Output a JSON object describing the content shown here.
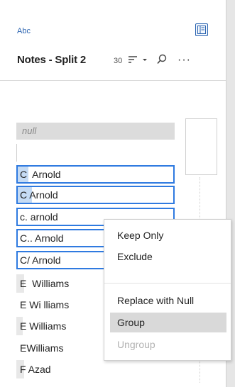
{
  "field": {
    "type_label": "Abc",
    "name": "Notes - Split 2",
    "count": "30"
  },
  "null_value": "null",
  "values": [
    {
      "label": "C  Arnold",
      "selected": true,
      "fill": 0.07
    },
    {
      "label": "C Arnold",
      "selected": true,
      "fill": 0.09
    },
    {
      "label": "c. arnold",
      "selected": true,
      "fill": 0.0
    },
    {
      "label": "C.. Arnold",
      "selected": true,
      "fill": 0.0
    },
    {
      "label": "C/ Arnold",
      "selected": true,
      "fill": 0.0
    },
    {
      "label": "E  Williams",
      "selected": false,
      "fill": 0.05
    },
    {
      "label": "E Wi lliams",
      "selected": false,
      "fill": 0.0
    },
    {
      "label": "E Williams",
      "selected": false,
      "fill": 0.04
    },
    {
      "label": "EWilliams",
      "selected": false,
      "fill": 0.0
    },
    {
      "label": "F Azad",
      "selected": false,
      "fill": 0.05
    }
  ],
  "context_menu": {
    "items": [
      {
        "label": "Keep Only",
        "state": "normal"
      },
      {
        "label": "Exclude",
        "state": "normal"
      },
      {
        "label": "Replace with Null",
        "state": "normal"
      },
      {
        "label": "Group",
        "state": "hover"
      },
      {
        "label": "Ungroup",
        "state": "disabled"
      }
    ]
  },
  "colors": {
    "accent": "#2f7ae0",
    "selection_fill": "#c5dbf4",
    "menu_hover": "#d9d9d9"
  },
  "icons": {
    "panel_toggle": "panel-toggle-icon",
    "sort": "sort-icon",
    "dropdown": "chevron-down-icon",
    "search": "search-icon",
    "more": "more-options-icon"
  }
}
